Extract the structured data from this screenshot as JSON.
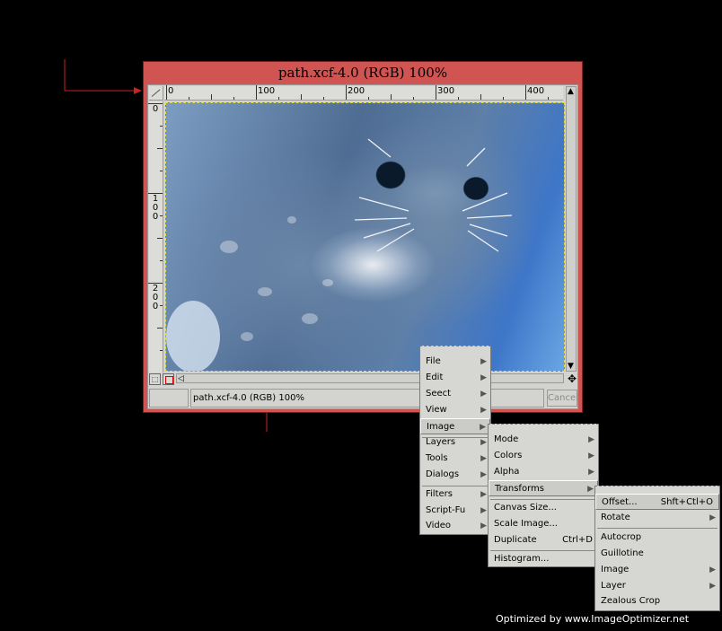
{
  "window": {
    "title": "path.xcf-4.0 (RGB) 100%"
  },
  "ruler": {
    "h_labels": [
      "0",
      "100",
      "200",
      "300",
      "400"
    ],
    "v_labels": [
      "0",
      "100",
      "200"
    ]
  },
  "status": {
    "text": "path.xcf-4.0 (RGB) 100%",
    "cancel_label": "Cancel"
  },
  "menu1": {
    "file": "File",
    "edit": "Edit",
    "select": "Seect",
    "view": "View",
    "image": "Image",
    "layers": "Layers",
    "tools": "Tools",
    "dialogs": "Dialogs",
    "filters": "Filters",
    "scriptfu": "Script-Fu",
    "video": "Video"
  },
  "menu2": {
    "mode": "Mode",
    "colors": "Colors",
    "alpha": "Alpha",
    "transforms": "Transforms",
    "canvas_size": "Canvas Size...",
    "scale_image": "Scale Image...",
    "duplicate": "Duplicate",
    "duplicate_shortcut": "Ctrl+D",
    "histogram": "Histogram..."
  },
  "menu3": {
    "offset": "Offset...",
    "offset_shortcut": "Shft+Ctl+O",
    "rotate": "Rotate",
    "autocrop": "Autocrop",
    "guillotine": "Guillotine",
    "image": "Image",
    "layer": "Layer",
    "zealous_crop": "Zealous Crop"
  },
  "footer": {
    "text": "Optimized by www.ImageOptimizer.net"
  },
  "colors": {
    "titlebar": "#cf5452",
    "annotation_arrow": "#cc2222",
    "background": "#000000"
  }
}
